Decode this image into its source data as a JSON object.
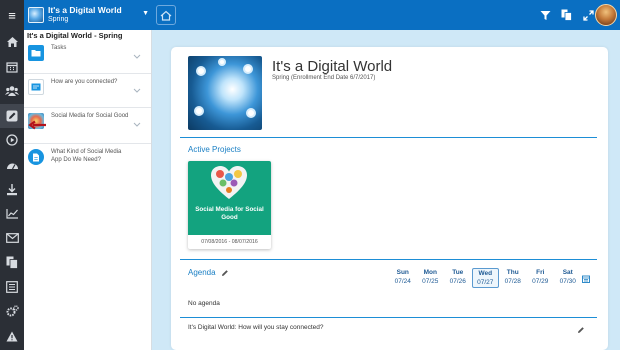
{
  "topbar": {
    "course_title": "It's a Digital World",
    "course_term": "Spring",
    "icons": [
      "filter-icon",
      "copy-icon",
      "expand-icon"
    ]
  },
  "rail": {
    "items": [
      "home-icon",
      "calendar-icon",
      "people-icon",
      "edit-icon",
      "play-icon",
      "dashboard-icon",
      "download-icon",
      "chart-icon",
      "mail-icon",
      "files-icon",
      "list-icon",
      "settings-icon",
      "warning-icon"
    ],
    "active": "edit-icon"
  },
  "sidebar": {
    "title": "It's a Digital World - Spring",
    "items": [
      {
        "label": "Tasks",
        "icon": "folder-icon"
      },
      {
        "label": "How are you connected?",
        "icon": "document-icon"
      },
      {
        "label": "Social Media for Social Good",
        "icon": "project-image-icon"
      },
      {
        "label": "What Kind of Social Media App Do We Need?",
        "icon": "document-icon"
      }
    ]
  },
  "main": {
    "course_title": "It's a Digital World",
    "course_subtitle": "Spring (Enrollment End Date 6/7/2017)",
    "active_projects_title": "Active Projects",
    "project": {
      "name": "Social Media for Social Good",
      "dates": "07/08/2016 - 08/07/2016"
    },
    "agenda": {
      "title": "Agenda",
      "days": [
        {
          "name": "Sun",
          "date": "07/24"
        },
        {
          "name": "Mon",
          "date": "07/25"
        },
        {
          "name": "Tue",
          "date": "07/26"
        },
        {
          "name": "Wed",
          "date": "07/27",
          "today": true
        },
        {
          "name": "Thu",
          "date": "07/28"
        },
        {
          "name": "Fri",
          "date": "07/29"
        },
        {
          "name": "Sat",
          "date": "07/30"
        }
      ],
      "empty_text": "No agenda"
    },
    "discussion": "It's Digital World: How will you stay connected?"
  },
  "colors": {
    "topbar": "#0a6fc2",
    "rail": "#2b2f36",
    "accent": "#1a7fc4",
    "project_green": "#13a37f",
    "background": "#cfe8f7"
  }
}
